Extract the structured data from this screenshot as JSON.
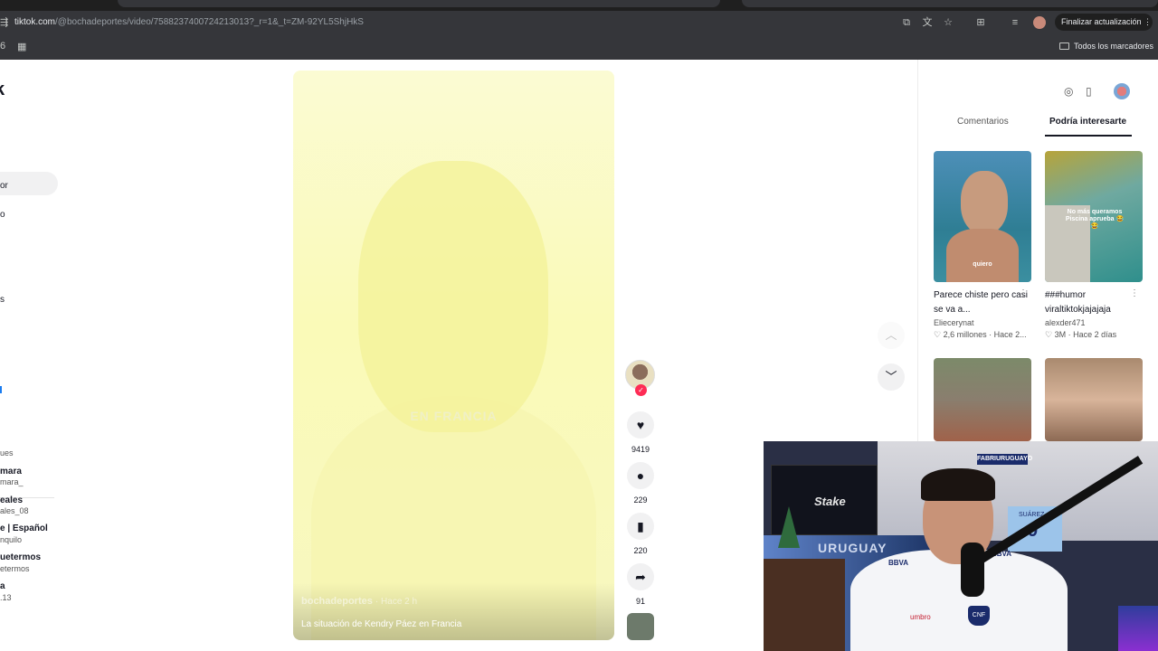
{
  "browser": {
    "url_domain": "tiktok.com",
    "url_path": "/@bochadeportes/video/7588237400724213013?_r=1&_t=ZM-92YL5ShjHkS",
    "update_button": "Finalizar actualización",
    "all_bookmarks": "Todos los marcadores"
  },
  "leftnav": {
    "logo": "k",
    "fragments": [
      "or",
      "o",
      "s"
    ],
    "following_header": "ues",
    "accounts": [
      {
        "name": "mara",
        "handle": "mara_"
      },
      {
        "name": "eales",
        "handle": "ales_08"
      },
      {
        "name": "e | Español",
        "handle": "nquilo"
      },
      {
        "name": "uetermos",
        "handle": "etermos"
      },
      {
        "name": "a",
        "handle": ".13"
      }
    ]
  },
  "video": {
    "overlay_text": "EN FRANCIA",
    "author": "bochadeportes",
    "time_ago": "· Hace 2 h",
    "caption": "La situación de Kendry Páez en Francia"
  },
  "actions": {
    "likes": "9419",
    "comments": "229",
    "saves": "220",
    "shares": "91"
  },
  "rightpanel": {
    "tabs": [
      "Comentarios",
      "Podría interesarte"
    ],
    "active_tab": "Podría interesarte",
    "cards": [
      {
        "title": "Parece chiste pero casi se va a...",
        "user": "Eliecerynat",
        "likes": "2,6 millones",
        "time": "Hace 2...",
        "thumb_text": "quiero"
      },
      {
        "title": "###humor viraltiktokjajajaja",
        "user": "alexder471",
        "likes": "3M",
        "time": "Hace 2 días",
        "thumb_text": "No más queramos Piscina aprueba 😂😂"
      }
    ]
  },
  "webcam": {
    "tv_logo": "Stake",
    "banner": "FABRIURUGUAYO",
    "flag_text": "URUGUAY",
    "jersey_name": "SUÁREZ",
    "jersey_number": "9",
    "shirt_sponsor": "BBVA",
    "shirt_brand": "umbro",
    "crest": "CNF"
  }
}
